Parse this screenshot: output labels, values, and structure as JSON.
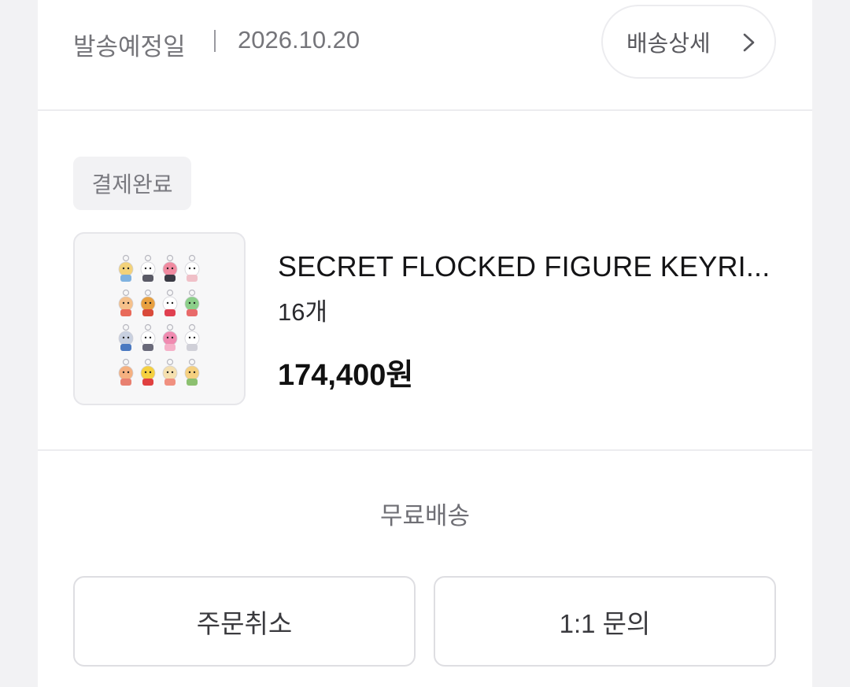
{
  "shipping": {
    "label": "발송예정일",
    "date": "2026.10.20",
    "detail_button": "배송상세"
  },
  "order": {
    "status": "결제완료",
    "product_name": "SECRET FLOCKED FIGURE KEYRI...",
    "quantity": "16개",
    "price": "174,400원"
  },
  "delivery_fee": "무료배송",
  "actions": {
    "cancel": "주문취소",
    "inquiry": "1:1 문의"
  },
  "icons": {
    "detail_chevron": "chevron-right-icon"
  }
}
